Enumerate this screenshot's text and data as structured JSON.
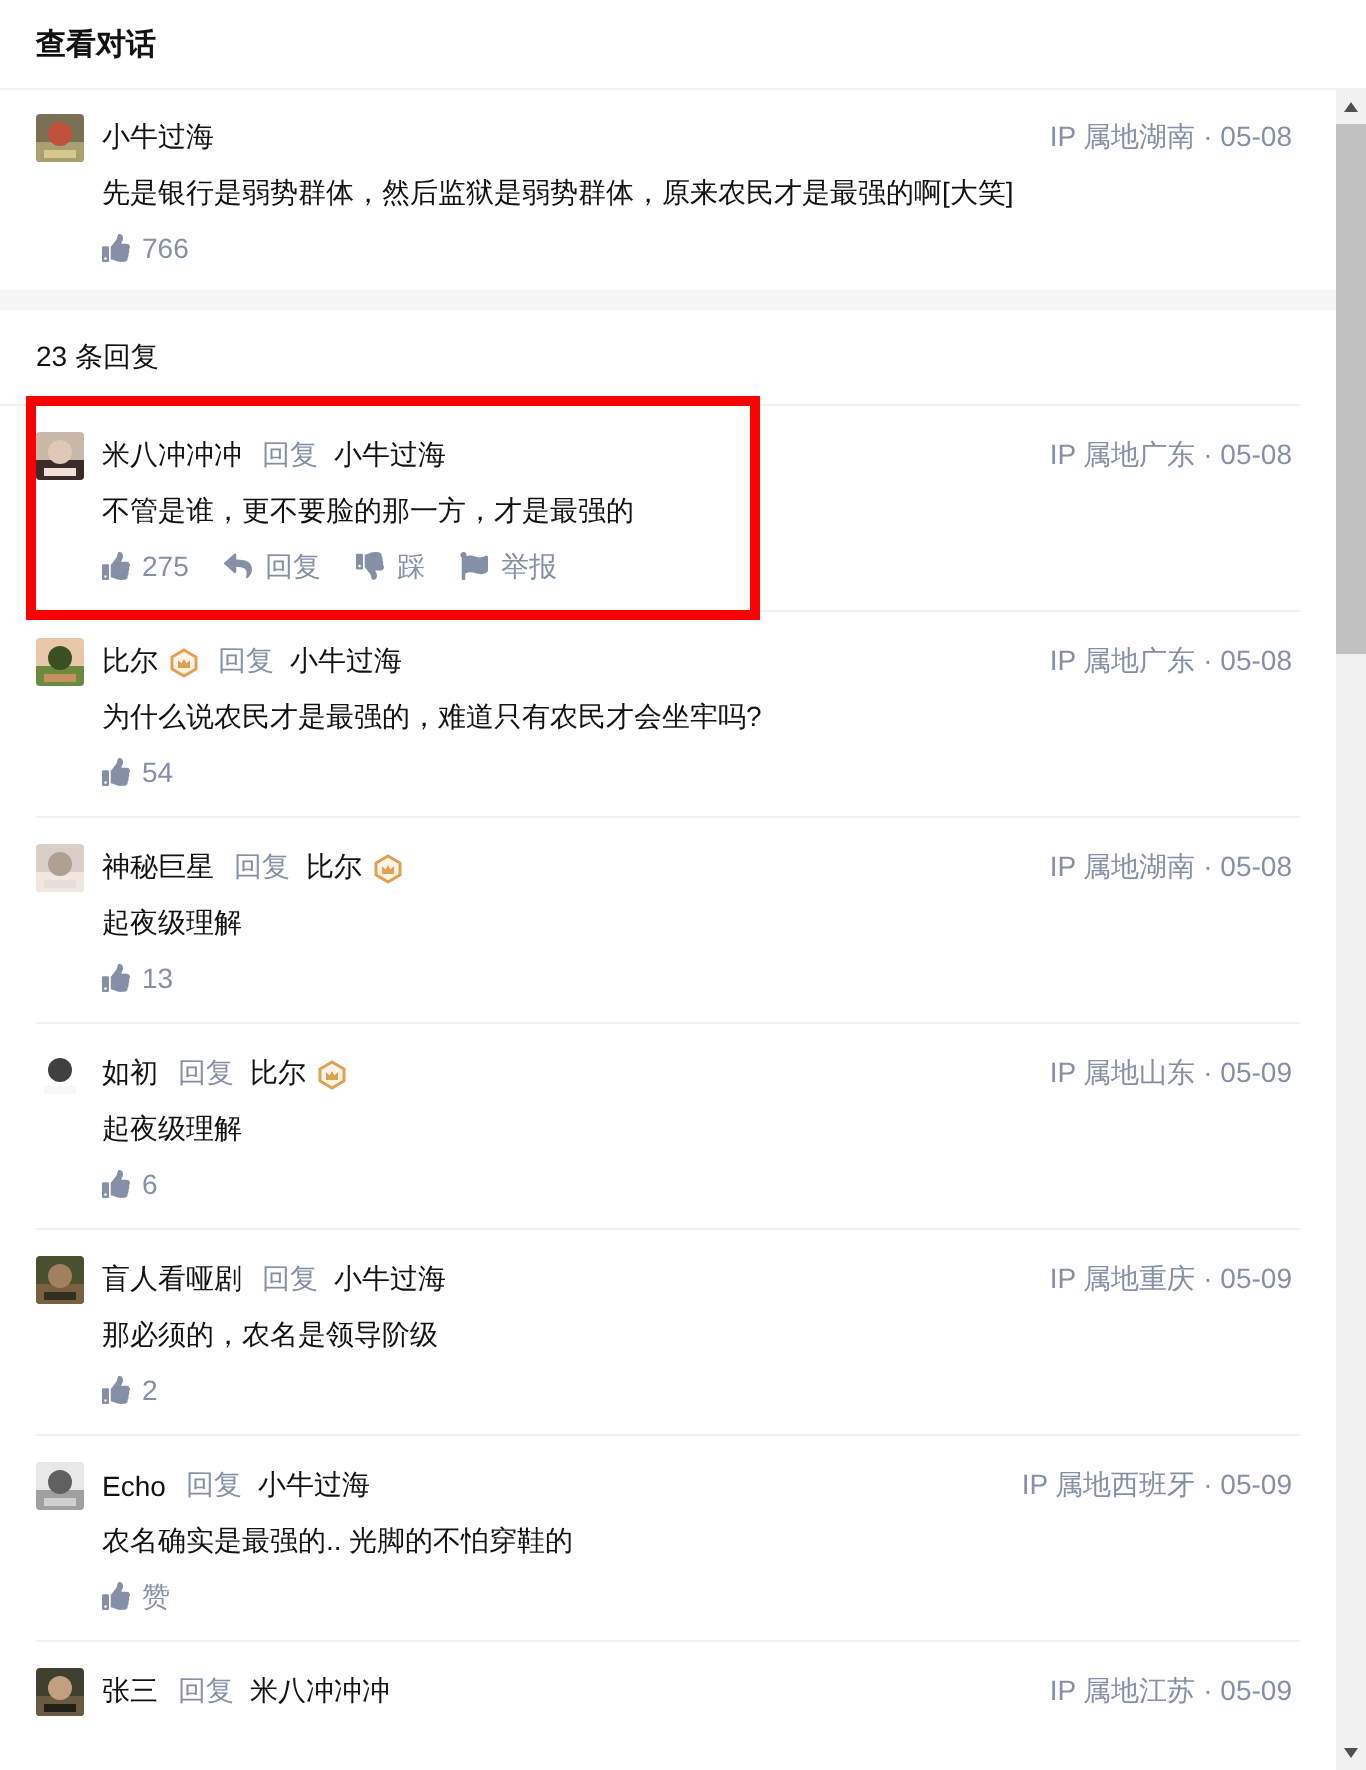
{
  "header": {
    "title": "查看对话"
  },
  "root_comment": {
    "author": "小牛过海",
    "badge": false,
    "meta": "IP 属地湖南 · 05-08",
    "text": "先是银行是弱势群体，然后监狱是弱势群体，原来农民才是最强的啊[大笑]",
    "actions": [
      {
        "kind": "like",
        "label": "766"
      }
    ]
  },
  "reply_count": "23 条回复",
  "replies": [
    {
      "author": "米八冲冲冲",
      "badge": false,
      "reply_label": "回复",
      "reply_to": "小牛过海",
      "reply_to_badge": false,
      "meta": "IP 属地广东 · 05-08",
      "text": "不管是谁，更不要脸的那一方，才是最强的",
      "highlighted": true,
      "actions": [
        {
          "kind": "like",
          "label": "275"
        },
        {
          "kind": "reply",
          "label": "回复"
        },
        {
          "kind": "dislike",
          "label": "踩"
        },
        {
          "kind": "report",
          "label": "举报"
        }
      ]
    },
    {
      "author": "比尔",
      "badge": true,
      "reply_label": "回复",
      "reply_to": "小牛过海",
      "reply_to_badge": false,
      "meta": "IP 属地广东 · 05-08",
      "text": "为什么说农民才是最强的，难道只有农民才会坐牢吗?",
      "highlighted": false,
      "actions": [
        {
          "kind": "like",
          "label": "54"
        }
      ]
    },
    {
      "author": "神秘巨星",
      "badge": false,
      "reply_label": "回复",
      "reply_to": "比尔",
      "reply_to_badge": true,
      "meta": "IP 属地湖南 · 05-08",
      "text": "起夜级理解",
      "highlighted": false,
      "actions": [
        {
          "kind": "like",
          "label": "13"
        }
      ]
    },
    {
      "author": "如初",
      "badge": false,
      "reply_label": "回复",
      "reply_to": "比尔",
      "reply_to_badge": true,
      "meta": "IP 属地山东 · 05-09",
      "text": "起夜级理解",
      "highlighted": false,
      "actions": [
        {
          "kind": "like",
          "label": "6"
        }
      ]
    },
    {
      "author": "盲人看哑剧",
      "badge": false,
      "reply_label": "回复",
      "reply_to": "小牛过海",
      "reply_to_badge": false,
      "meta": "IP 属地重庆 · 05-09",
      "text": "那必须的，农名是领导阶级",
      "highlighted": false,
      "actions": [
        {
          "kind": "like",
          "label": "2"
        }
      ]
    },
    {
      "author": "Echo",
      "badge": false,
      "reply_label": "回复",
      "reply_to": "小牛过海",
      "reply_to_badge": false,
      "meta": "IP 属地西班牙 · 05-09",
      "text": "农名确实是最强的.. 光脚的不怕穿鞋的",
      "highlighted": false,
      "actions": [
        {
          "kind": "like",
          "label": "赞"
        }
      ]
    },
    {
      "author": "张三",
      "badge": false,
      "reply_label": "回复",
      "reply_to": "米八冲冲冲",
      "reply_to_badge": false,
      "meta": "IP 属地江苏 · 05-09",
      "highlighted": false
    }
  ]
}
